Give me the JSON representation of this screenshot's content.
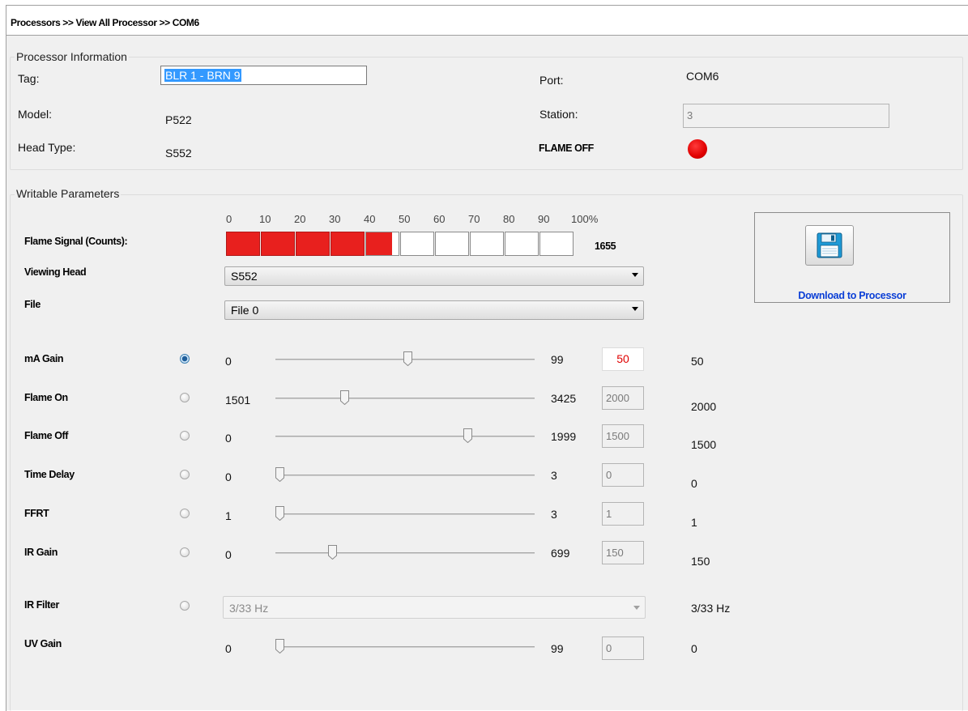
{
  "breadcrumb": "Processors >> View All Processor >> COM6",
  "processor_info": {
    "legend": "Processor Information",
    "tag_label": "Tag:",
    "tag_value": "BLR 1 - BRN 9",
    "model_label": "Model:",
    "model_value": "P522",
    "head_type_label": "Head Type:",
    "head_type_value": "S552",
    "port_label": "Port:",
    "port_value": "COM6",
    "station_label": "Station:",
    "station_value": "3",
    "flame_status": "FLAME OFF",
    "flame_status_color": "#e00000"
  },
  "writable": {
    "legend": "Writable Parameters",
    "flame_signal_label": "Flame Signal (Counts):",
    "scale_ticks": [
      "0",
      "10",
      "20",
      "30",
      "40",
      "50",
      "60",
      "70",
      "80",
      "90",
      "100%"
    ],
    "flame_signal_fill_percent": 48,
    "flame_signal_value": "1655",
    "viewing_head_label": "Viewing Head",
    "viewing_head_value": "S552",
    "file_label": "File",
    "file_value": "File 0",
    "download_label": "Download to Processor",
    "download_icon": "save-floppy-icon",
    "params": [
      {
        "label": "mA Gain",
        "selected": true,
        "min": "0",
        "max": "99",
        "input": "50",
        "input_editable": true,
        "value": "50",
        "slider_fraction": 0.51
      },
      {
        "label": "Flame On",
        "selected": false,
        "min": "1501",
        "max": "3425",
        "input": "2000",
        "input_editable": false,
        "value": "2000",
        "slider_fraction": 0.26
      },
      {
        "label": "Flame Off",
        "selected": false,
        "min": "0",
        "max": "1999",
        "input": "1500",
        "input_editable": false,
        "value": "1500",
        "slider_fraction": 0.75
      },
      {
        "label": "Time Delay",
        "selected": false,
        "min": "0",
        "max": "3",
        "input": "0",
        "input_editable": false,
        "value": "0",
        "slider_fraction": 0
      },
      {
        "label": "FFRT",
        "selected": false,
        "min": "1",
        "max": "3",
        "input": "1",
        "input_editable": false,
        "value": "1",
        "slider_fraction": 0
      },
      {
        "label": "IR Gain",
        "selected": false,
        "min": "0",
        "max": "699",
        "input": "150",
        "input_editable": false,
        "value": "150",
        "slider_fraction": 0.21
      }
    ],
    "ir_filter_label": "IR Filter",
    "ir_filter_value": "3/33 Hz",
    "ir_filter_display": "3/33 Hz",
    "uv_gain": {
      "label": "UV Gain",
      "min": "0",
      "max": "99",
      "input": "0",
      "value": "0",
      "slider_fraction": 0
    }
  },
  "colors": {
    "bar_fill": "#e8201e",
    "editable_input_text": "#e00000",
    "download_text": "#0a3ed6"
  }
}
